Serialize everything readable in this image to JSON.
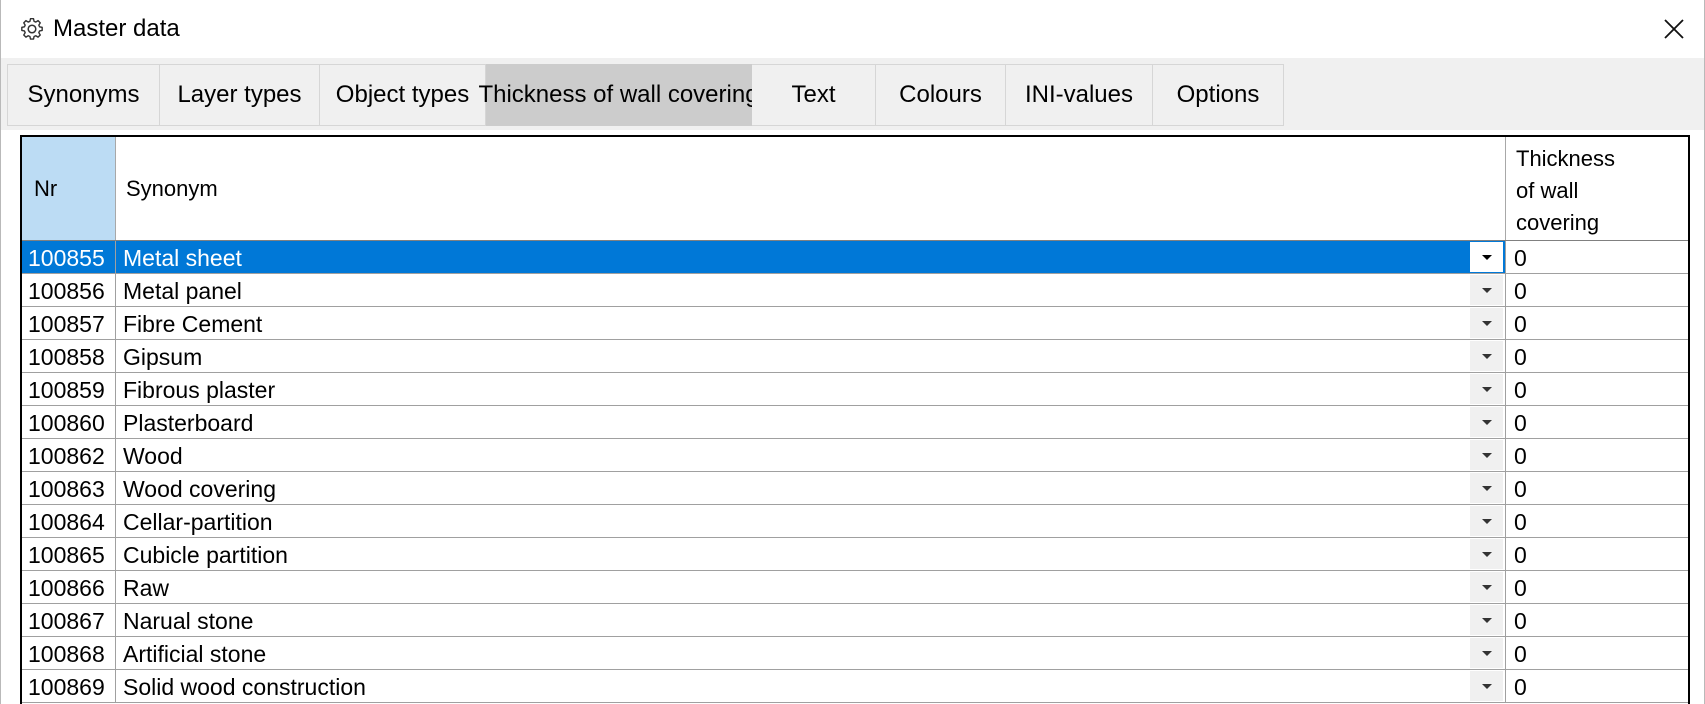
{
  "window": {
    "title": "Master data",
    "icon": "gear-icon",
    "close_icon": "close-icon"
  },
  "tabs": [
    {
      "label": "Synonyms",
      "active": false
    },
    {
      "label": "Layer types",
      "active": false
    },
    {
      "label": "Object types",
      "active": false
    },
    {
      "label": "Thickness of wall covering",
      "active": true
    },
    {
      "label": "Text",
      "active": false
    },
    {
      "label": "Colours",
      "active": false
    },
    {
      "label": "INI-values",
      "active": false
    },
    {
      "label": "Options",
      "active": false
    }
  ],
  "grid": {
    "headers": {
      "nr": "Nr",
      "synonym": "Synonym",
      "thickness": "Thickness\nof wall\ncovering"
    },
    "selected_row": 0,
    "rows": [
      {
        "nr": "100855",
        "synonym": "Metal sheet",
        "thickness": "0"
      },
      {
        "nr": "100856",
        "synonym": "Metal panel",
        "thickness": "0"
      },
      {
        "nr": "100857",
        "synonym": "Fibre Cement",
        "thickness": "0"
      },
      {
        "nr": "100858",
        "synonym": "Gipsum",
        "thickness": "0"
      },
      {
        "nr": "100859",
        "synonym": "Fibrous plaster",
        "thickness": "0"
      },
      {
        "nr": "100860",
        "synonym": "Plasterboard",
        "thickness": "0"
      },
      {
        "nr": "100862",
        "synonym": "Wood",
        "thickness": "0"
      },
      {
        "nr": "100863",
        "synonym": "Wood covering",
        "thickness": "0"
      },
      {
        "nr": "100864",
        "synonym": "Cellar-partition",
        "thickness": "0"
      },
      {
        "nr": "100865",
        "synonym": "Cubicle partition",
        "thickness": "0"
      },
      {
        "nr": "100866",
        "synonym": "Raw",
        "thickness": "0"
      },
      {
        "nr": "100867",
        "synonym": "Narual stone",
        "thickness": "0"
      },
      {
        "nr": "100868",
        "synonym": "Artificial stone",
        "thickness": "0"
      },
      {
        "nr": "100869",
        "synonym": "Solid wood construction",
        "thickness": "0"
      }
    ]
  },
  "colors": {
    "selection": "#0078d7",
    "header_nr_bg": "#bcdcf4",
    "active_tab_bg": "#cccccc",
    "tab_bg": "#f0f0f0"
  }
}
